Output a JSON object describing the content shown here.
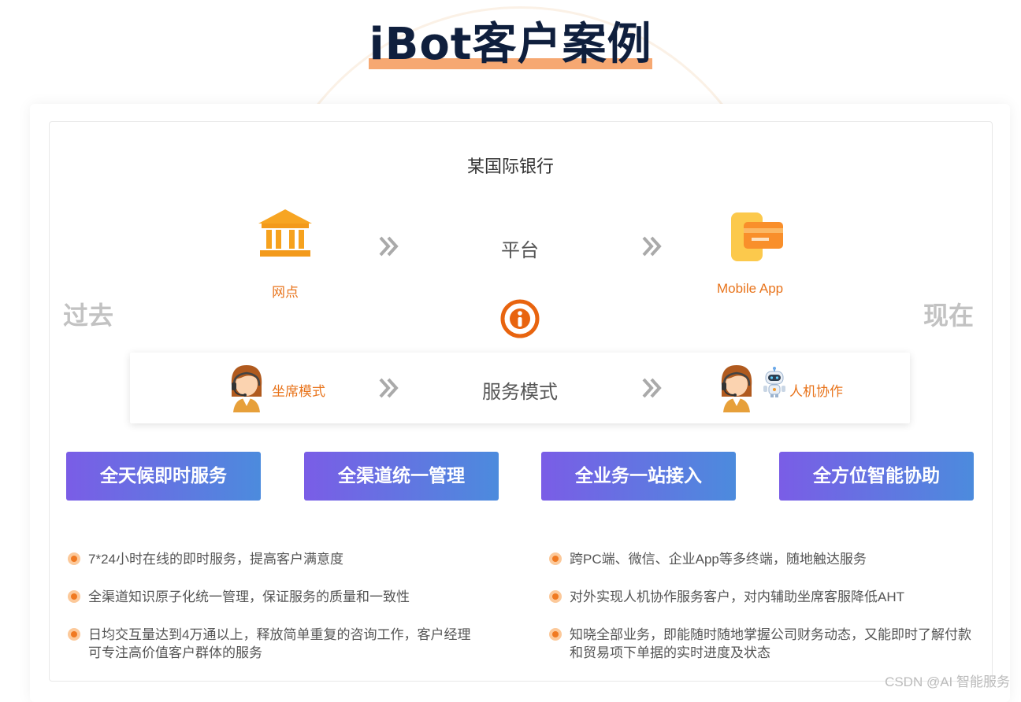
{
  "page": {
    "title": "iBot客户案例"
  },
  "case": {
    "bank": "某国际银行",
    "past_label": "过去",
    "now_label": "现在",
    "platform_row": {
      "left": "网点",
      "middle": "平台",
      "right": "Mobile App"
    },
    "service_row": {
      "left": "坐席模式",
      "middle": "服务模式",
      "right": "人机协作"
    }
  },
  "pills": [
    "全天候即时服务",
    "全渠道统一管理",
    "全业务一站接入",
    "全方位智能协助"
  ],
  "features_left": [
    "7*24小时在线的即时服务，提高客户满意度",
    "全渠道知识原子化统一管理，保证服务的质量和一致性",
    "日均交互量达到4万通以上，释放简单重复的咨询工作，客户经理可专注高价值客户群体的服务"
  ],
  "features_right": [
    "跨PC端、微信、企业App等多终端，随地触达服务",
    "对外实现人机协作服务客户，对内辅助坐席客服降低AHT",
    "知晓全部业务，即能随时随地掌握公司财务动态，又能即时了解付款和贸易项下单据的实时进度及状态"
  ],
  "watermark": "CSDN @AI 智能服务",
  "colors": {
    "accent_orange": "#e8741c",
    "pill_start": "#7a5de6",
    "pill_end": "#4c8bdd",
    "title": "#0f1f3d",
    "highlight": "#f6a872"
  }
}
